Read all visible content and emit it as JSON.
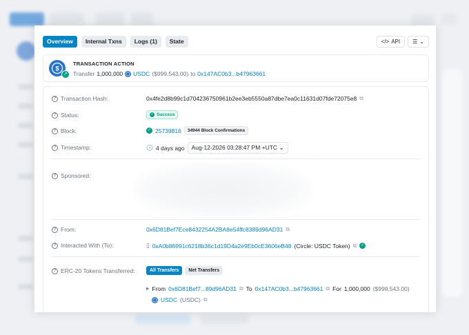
{
  "tabs": [
    {
      "label": "Overview",
      "active": true
    },
    {
      "label": "Internal Txns",
      "active": false
    },
    {
      "label": "Logs (1)",
      "active": false
    },
    {
      "label": "State",
      "active": false
    }
  ],
  "tools": {
    "api_label": "API"
  },
  "action": {
    "title": "TRANSACTION ACTION",
    "verb": "Transfer",
    "amount": "1,000,000",
    "token": "USDC",
    "usd_value": "($999,543.00)",
    "to_word": "to",
    "to_address": "0x147AC0b3...b47963661"
  },
  "details": {
    "hash_label": "Transaction Hash:",
    "hash_value": "0x4fe2d8b99c1d704236750961b2ee3eb5550a87dbe7ea0c11631d07fde72075e8",
    "status_label": "Status:",
    "status_value": "Success",
    "block_label": "Block:",
    "block_value": "25739816",
    "confirmations": "34944 Block Confirmations",
    "timestamp_label": "Timestamp:",
    "timestamp_ago": "4 days ago",
    "timestamp_value": "Aug-12-2026 03:28:47 PM +UTC",
    "sponsored_label": "Sponsored:",
    "from_label": "From:",
    "from_value": "0x6D81Bef7Ece8432254A2BA8e54ffc8389d96AD31",
    "to_label": "Interacted With (To):",
    "to_value": "0xA0b86991c6218b36c1d19D4a2e9Eb0cE3606eB48",
    "to_name": "(Circle: USDC Token)",
    "erc20_label": "ERC-20 Tokens Transferred:",
    "btn_all": "All Transfers",
    "btn_net": "Net Transfers",
    "transfer": {
      "from_word": "From",
      "from_addr": "0x6D81Bef7...89d96AD31",
      "to_word": "To",
      "to_addr": "0x147AC0b3...b47963661",
      "for_word": "For",
      "amount": "1,000,000",
      "usd": "($999,543.00)",
      "token": "USDC",
      "token_sym": "(USDC)"
    }
  },
  "colors": {
    "accent": "#0784c3",
    "success": "#00a186",
    "usdc": "#2775ca"
  }
}
